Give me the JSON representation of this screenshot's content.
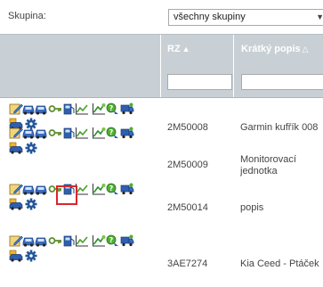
{
  "filter": {
    "label": "Skupina:",
    "selected": "všechny skupiny"
  },
  "columns": {
    "rz": "RZ",
    "desc": "Krátký popis"
  },
  "colors": {
    "header_bg": "#c8d0d5",
    "highlight": "#d9262d"
  },
  "icons": [
    "edit-icon",
    "car-icon",
    "car-icon",
    "key-icon",
    "fuel-icon",
    "chart-icon",
    "route-icon",
    "location-icon",
    "truck-icon",
    "vehicle-icon",
    "gear-icon"
  ],
  "rows": [
    {
      "rz": "2M50008",
      "desc": "Garmin kufřík 008"
    },
    {
      "rz": "2M50009",
      "desc": "Monitorovací jednotka"
    },
    {
      "rz": "2M50014",
      "desc": "popis"
    },
    {
      "rz": "3AE7274",
      "desc": "Kia Ceed - Ptáček"
    }
  ]
}
